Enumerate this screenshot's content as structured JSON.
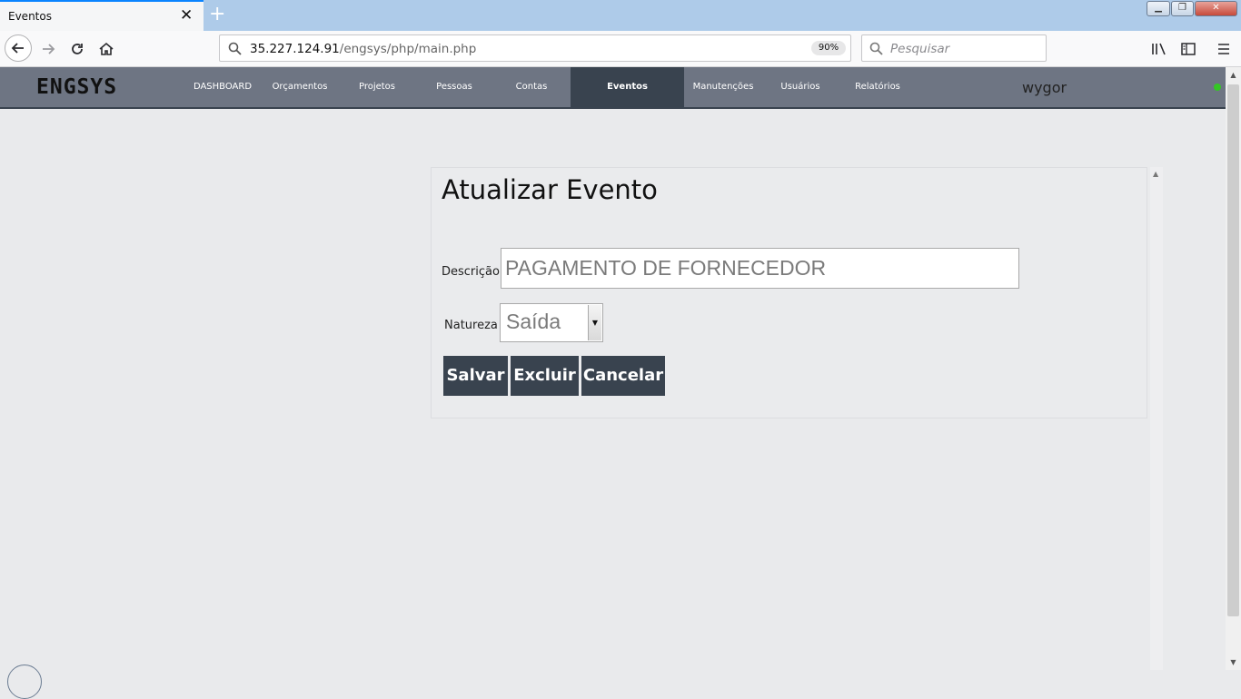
{
  "browser": {
    "tab_title": "Eventos",
    "tab_close": "✕",
    "new_tab": "+",
    "url_host": "35.227.124.91",
    "url_path": "/engsys/php/main.php",
    "zoom": "90%",
    "search_placeholder": "Pesquisar"
  },
  "app": {
    "logo": "ENGSYS",
    "menu": [
      {
        "label": "DASHBOARD"
      },
      {
        "label": "Orçamentos"
      },
      {
        "label": "Projetos"
      },
      {
        "label": "Pessoas"
      },
      {
        "label": "Contas"
      },
      {
        "label": "Eventos",
        "active": true
      },
      {
        "label": "Manutenções"
      },
      {
        "label": "Usuários"
      },
      {
        "label": "Relatórios"
      }
    ],
    "user": "wygor",
    "status_color": "#34c724"
  },
  "form": {
    "title": "Atualizar Evento",
    "descricao_label": "Descrição",
    "descricao_value": "PAGAMENTO DE FORNECEDOR",
    "natureza_label": "Natureza",
    "natureza_value": "Saída",
    "buttons": {
      "save": "Salvar",
      "delete": "Excluir",
      "cancel": "Cancelar"
    }
  },
  "colors": {
    "header_bg": "#6e7583",
    "accent_dark": "#39434f",
    "page_bg": "#e9eaec"
  }
}
